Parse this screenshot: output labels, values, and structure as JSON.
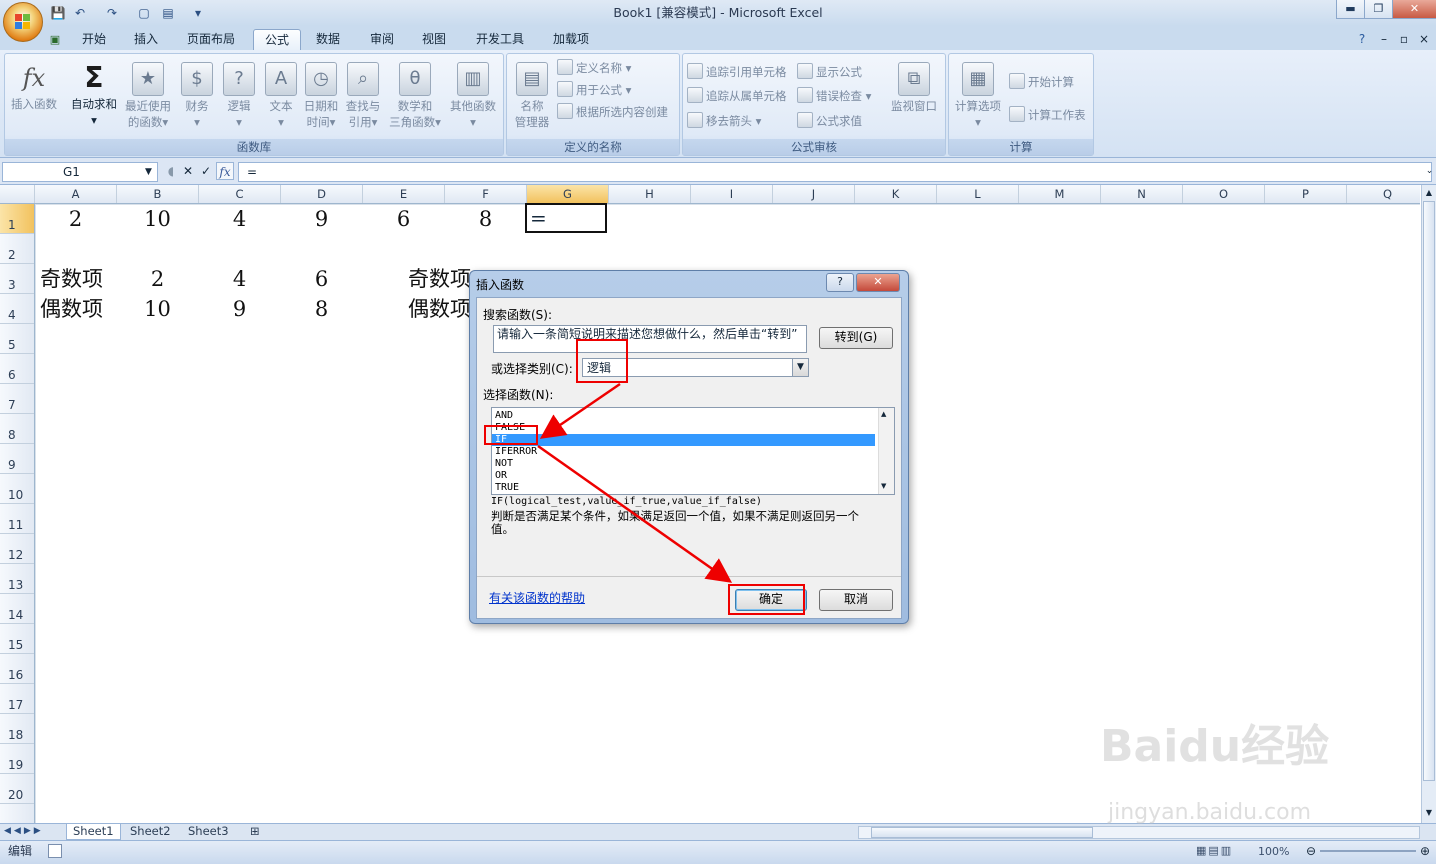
{
  "window": {
    "title": "Book1  [兼容模式] - Microsoft Excel",
    "min": "▬",
    "max": "❐",
    "close": "✕"
  },
  "ribbon": {
    "tabs": [
      "开始",
      "插入",
      "页面布局",
      "公式",
      "数据",
      "审阅",
      "视图",
      "开发工具",
      "加载项"
    ],
    "active_tab": "公式",
    "function_library": {
      "label": "函数库",
      "insert_function": "插入函数",
      "autosum": "自动求和",
      "recent": [
        "最近使用",
        "的函数"
      ],
      "financial": "财务",
      "logical": "逻辑",
      "text": "文本",
      "datetime": [
        "日期和",
        "时间"
      ],
      "lookup": [
        "查找与",
        "引用"
      ],
      "math": [
        "数学和",
        "三角函数"
      ],
      "more": "其他函数"
    },
    "defined_names": {
      "label": "定义的名称",
      "name_manager": [
        "名称",
        "管理器"
      ],
      "define_name": "定义名称",
      "use_in_formula": "用于公式",
      "create_from_selection": "根据所选内容创建"
    },
    "formula_auditing": {
      "label": "公式审核",
      "trace_precedents": "追踪引用单元格",
      "trace_dependents": "追踪从属单元格",
      "remove_arrows": "移去箭头",
      "show_formulas": "显示公式",
      "error_checking": "错误检查",
      "evaluate_formula": "公式求值",
      "watch_window": "监视窗口"
    },
    "calculation": {
      "label": "计算",
      "options": "计算选项",
      "calc_now": "开始计算",
      "calc_sheet": "计算工作表"
    }
  },
  "formula_bar": {
    "name_box": "G1",
    "formula": "="
  },
  "columns": [
    "A",
    "B",
    "C",
    "D",
    "E",
    "F",
    "G",
    "H",
    "I",
    "J",
    "K",
    "L",
    "M",
    "N",
    "O",
    "P",
    "Q"
  ],
  "selected_column": "G",
  "rows": [
    "1",
    "2",
    "3",
    "4",
    "5",
    "6",
    "7",
    "8",
    "9",
    "10",
    "11",
    "12",
    "13",
    "14",
    "15",
    "16",
    "17",
    "18",
    "19",
    "20"
  ],
  "cells": {
    "r1": [
      "2",
      "10",
      "4",
      "9",
      "6",
      "8"
    ],
    "active_value": "=",
    "r3_label": "奇数项",
    "r3": [
      "2",
      "4",
      "6"
    ],
    "r3_e": "奇数项",
    "r4_label": "偶数项",
    "r4": [
      "10",
      "9",
      "8"
    ],
    "r4_e": "偶数项"
  },
  "sheets": [
    "Sheet1",
    "Sheet2",
    "Sheet3"
  ],
  "status": {
    "mode": "编辑",
    "zoom": "100%"
  },
  "dialog": {
    "title": "插入函数",
    "help_btn": "?",
    "close_btn": "✕",
    "search_label": "搜索函数(S):",
    "search_text": "请输入一条简短说明来描述您想做什么，然后单击“转到”",
    "goto_btn": "转到(G)",
    "category_label": "或选择类别(C):",
    "category_value": "逻辑",
    "select_label": "选择函数(N):",
    "functions": [
      "AND",
      "FALSE",
      "IF",
      "IFERROR",
      "NOT",
      "OR",
      "TRUE"
    ],
    "selected_function": "IF",
    "syntax": "IF(logical_test,value_if_true,value_if_false)",
    "description": "判断是否满足某个条件，如果满足返回一个值，如果不满足则返回另一个值。",
    "help_link": "有关该函数的帮助",
    "ok": "确定",
    "cancel": "取消"
  },
  "watermark": {
    "brand": "Baidu经验",
    "url": "jingyan.baidu.com"
  },
  "colors": {
    "accent": "#3399ff",
    "highlight": "#e00000",
    "ribbon": "#dce6f4"
  }
}
